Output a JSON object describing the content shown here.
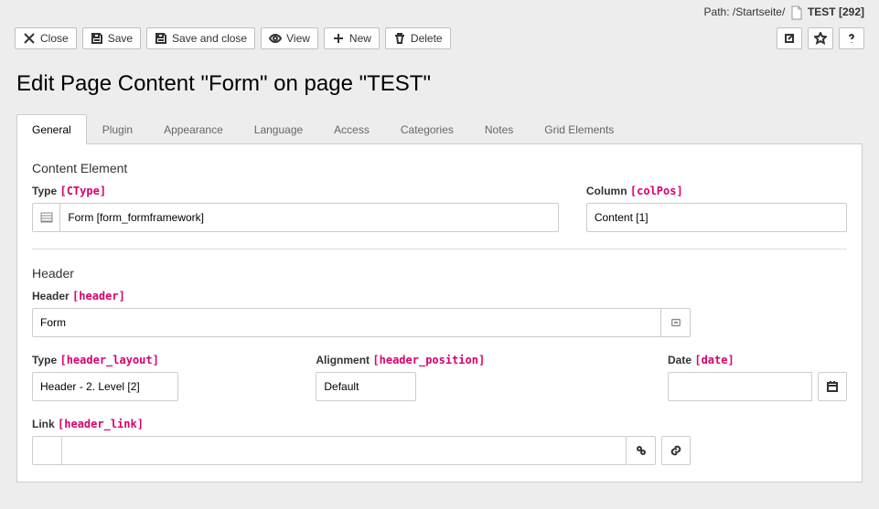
{
  "breadcrumb": {
    "label": "Path:",
    "root": "/Startseite/",
    "page": "TEST",
    "uid": "[292]"
  },
  "toolbar": {
    "close": "Close",
    "save": "Save",
    "save_close": "Save and close",
    "view": "View",
    "new": "New",
    "delete": "Delete"
  },
  "title": "Edit Page Content \"Form\" on page \"TEST\"",
  "tabs": [
    "General",
    "Plugin",
    "Appearance",
    "Language",
    "Access",
    "Categories",
    "Notes",
    "Grid Elements"
  ],
  "active_tab": 0,
  "section_element": {
    "title": "Content Element",
    "type": {
      "label": "Type",
      "tech": "[CType]",
      "value": "Form [form_formframework]"
    },
    "column": {
      "label": "Column",
      "tech": "[colPos]",
      "value": "Content [1]"
    }
  },
  "section_header": {
    "title": "Header",
    "header": {
      "label": "Header",
      "tech": "[header]",
      "value": "Form"
    },
    "type": {
      "label": "Type",
      "tech": "[header_layout]",
      "value": "Header - 2. Level [2]"
    },
    "align": {
      "label": "Alignment",
      "tech": "[header_position]",
      "value": "Default"
    },
    "date": {
      "label": "Date",
      "tech": "[date]",
      "value": ""
    },
    "link": {
      "label": "Link",
      "tech": "[header_link]",
      "value": ""
    }
  }
}
